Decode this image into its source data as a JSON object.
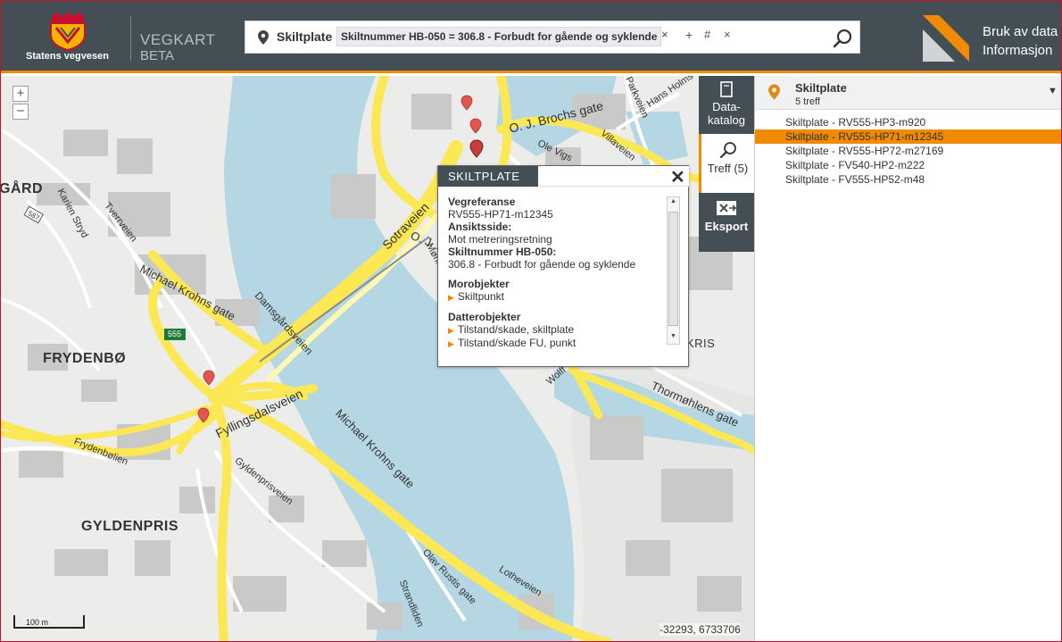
{
  "header": {
    "logo_text": "Statens vegvesen",
    "app_title": "VEGKART",
    "app_sub": "BETA",
    "links": [
      "Bruk av data",
      "Informasjon"
    ]
  },
  "search": {
    "type": "Skiltplate",
    "chip": "Skiltnummer HB-050 = 306.8 - Forbudt for gående og syklende",
    "chip_close": "×",
    "plus": "+",
    "hash": "#",
    "clear": "×"
  },
  "map": {
    "zoom_in": "+",
    "zoom_out": "−",
    "scale": "100 m",
    "coords": "-32293, 6733706",
    "places": [
      "GÅRD",
      "FRYDENBØ",
      "GYLDENPRIS",
      "KRIS"
    ],
    "streets": [
      "O. J. Brochs gate",
      "Sotraveien",
      "Michael Krohns gate",
      "Damsgårdsveien",
      "Fyllingsdalsveien",
      "Michael Krohns gate",
      "Thormøhlens gate",
      "Gyldenprisveien",
      "Frydenbølien",
      "Olav Rustis gate",
      "Lotheveien",
      "Tverrveien",
      "Karien Stryd",
      "Møhlenpriskaien",
      "Ole Vigs",
      "Villaveien",
      "Parkveien",
      "Hans Holms",
      "O. J. Bro",
      "Strandliden",
      "Wolff"
    ],
    "road_badges": [
      "587",
      "555"
    ]
  },
  "popup": {
    "title": "SKILTPLATE",
    "close": "✕",
    "fields": [
      {
        "label": "Vegreferanse",
        "value": "RV555-HP71-m12345"
      },
      {
        "label": "Ansiktsside:",
        "value": "Mot metreringsretning"
      },
      {
        "label": "Skiltnummer HB-050:",
        "value": "306.8 - Forbudt for gående og syklende"
      }
    ],
    "parent_title": "Morobjekter",
    "parents": [
      "Skiltpunkt"
    ],
    "children_title": "Datterobjekter",
    "children": [
      "Tilstand/skade, skiltplate",
      "Tilstand/skade FU, punkt"
    ]
  },
  "tabs": {
    "katalog": [
      "Data-",
      "katalog"
    ],
    "treff": "Treff (5)",
    "eksport": "Eksport"
  },
  "results": {
    "title": "Skiltplate",
    "count": "5 treff",
    "items": [
      "Skiltplate - RV555-HP3-m920",
      "Skiltplate - RV555-HP71-m12345",
      "Skiltplate - RV555-HP72-m27169",
      "Skiltplate - FV540-HP2-m222",
      "Skiltplate - FV555-HP52-m48"
    ],
    "selected_index": 1
  },
  "colors": {
    "header_bg": "#444f55",
    "accent": "#f08a00",
    "water": "#b5d7e3",
    "major_road": "#fce855",
    "marker": "#e0554f"
  }
}
